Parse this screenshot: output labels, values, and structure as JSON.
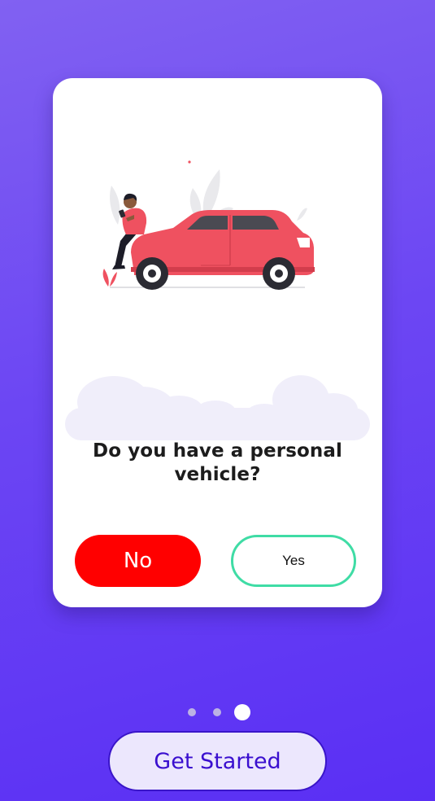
{
  "question": {
    "text": "Do you have a personal vehicle?"
  },
  "answers": {
    "no_label": "No",
    "yes_label": "Yes"
  },
  "pager": {
    "total": 3,
    "current": 3
  },
  "cta": {
    "label": "Get Started"
  },
  "colors": {
    "background_top": "#8161f2",
    "background_bottom": "#5a2ff4",
    "no_button": "#ff0000",
    "yes_border": "#3fdca5",
    "cta_text": "#3a0fcf",
    "cta_fill": "#ece7fd",
    "car": "#ef5160"
  },
  "illustration": {
    "icon": "person-on-car-illustration"
  }
}
